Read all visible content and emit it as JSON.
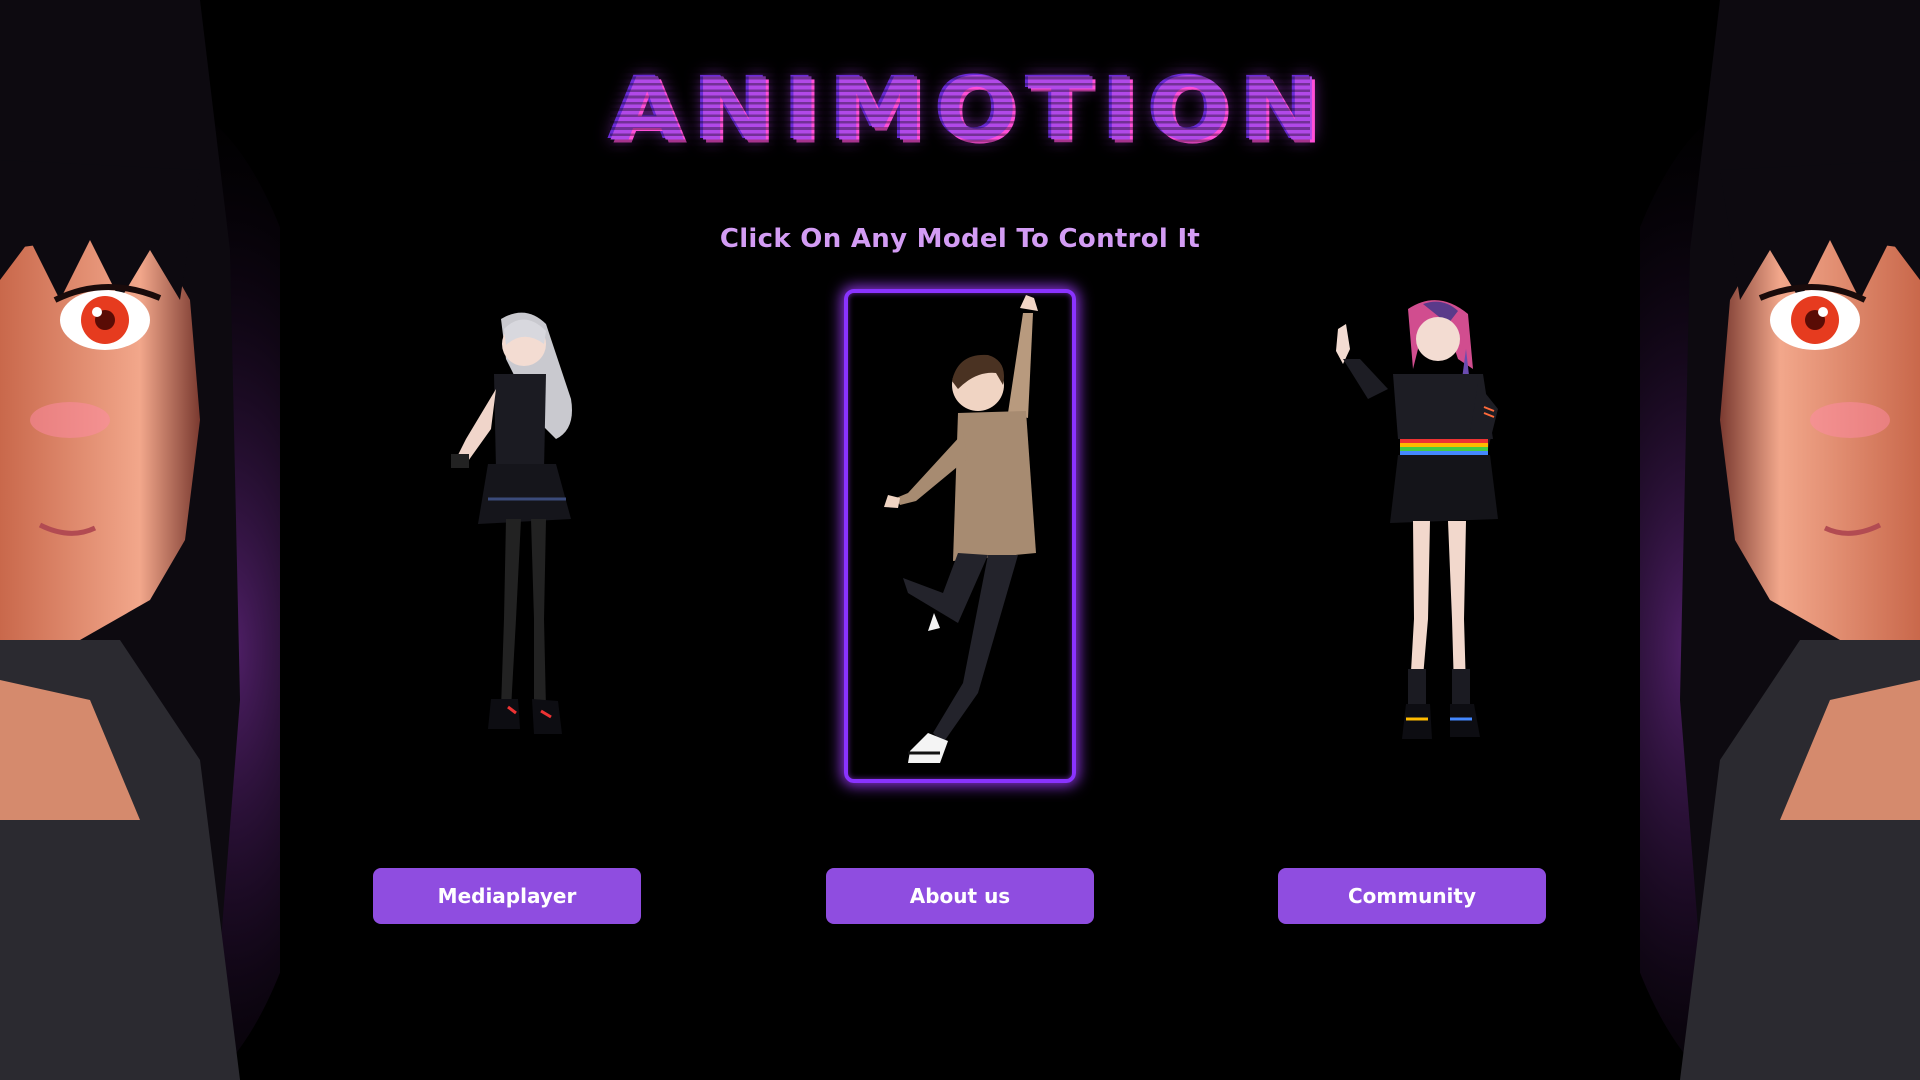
{
  "app": {
    "logo_text": "ANIMOTION"
  },
  "main": {
    "instruction": "Click On Any Model To Control It",
    "models": [
      {
        "name": "silver-haired-girl-model",
        "selected": false
      },
      {
        "name": "brown-haired-boy-model",
        "selected": true
      },
      {
        "name": "rainbow-haired-girl-model",
        "selected": false
      }
    ],
    "buttons": [
      {
        "label": "Mediaplayer"
      },
      {
        "label": "About us"
      },
      {
        "label": "Community"
      }
    ]
  },
  "colors": {
    "background": "#000000",
    "accent": "#8f4de0",
    "logo": "#b149e8",
    "instruction_text": "#d39cf4",
    "selection_border": "#8a33ff"
  }
}
